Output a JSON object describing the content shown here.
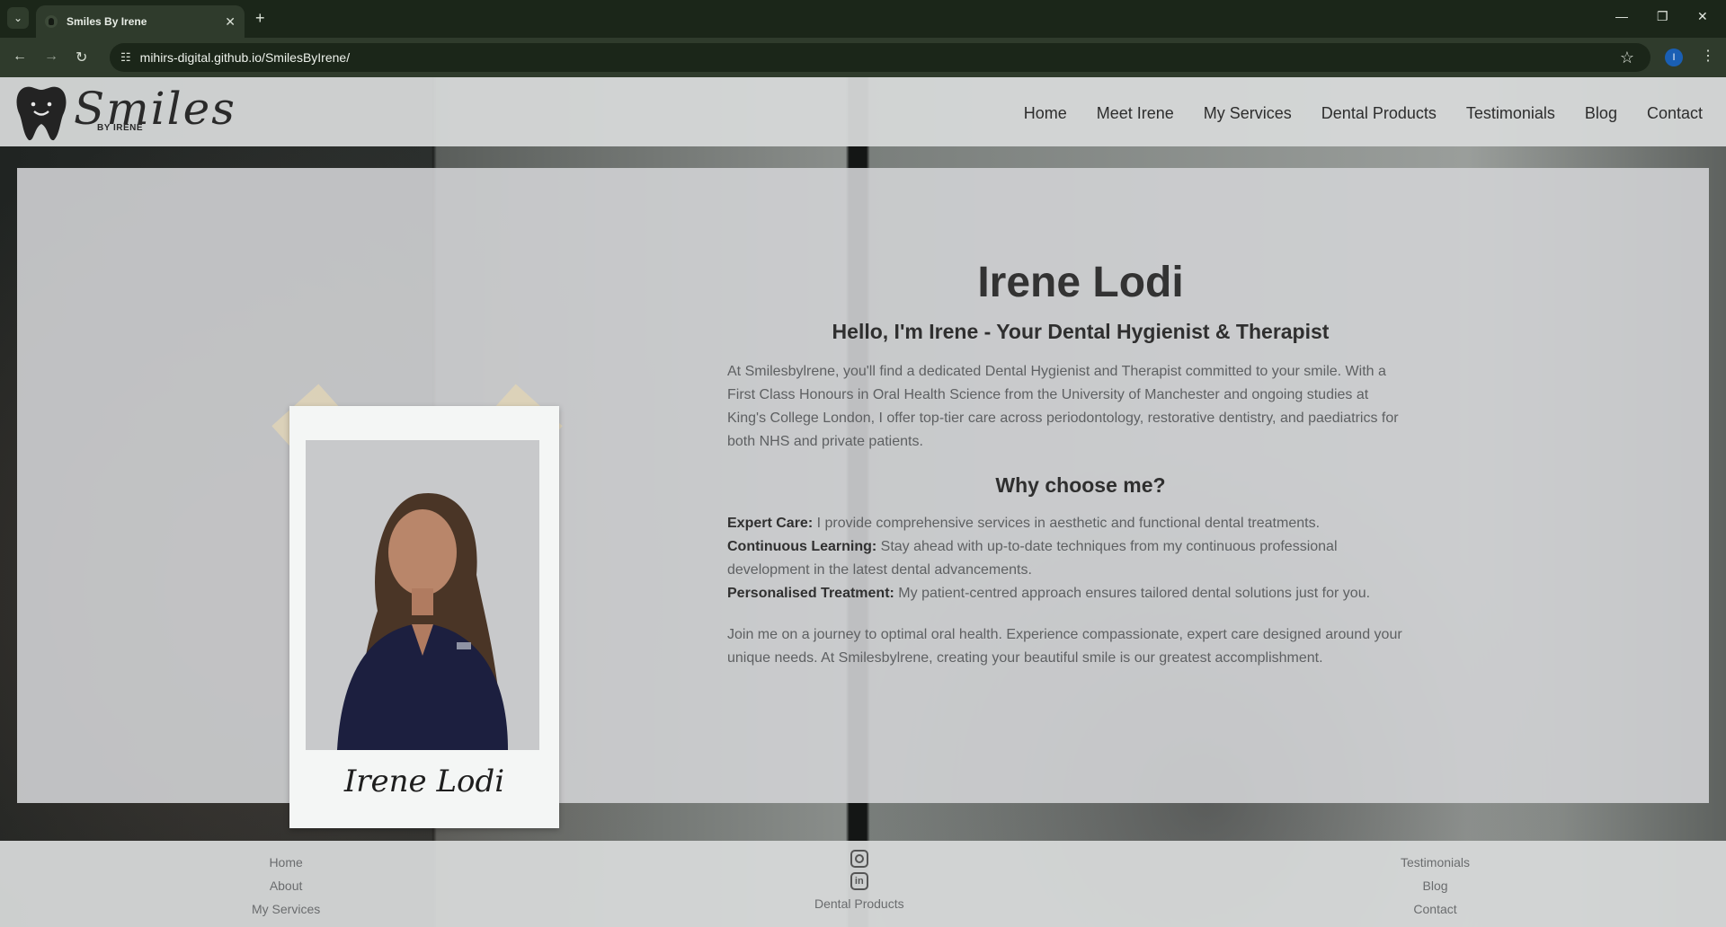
{
  "browser": {
    "tab_title": "Smiles By Irene",
    "url": "mihirs-digital.github.io/SmilesByIrene/",
    "profile_initial": "I"
  },
  "header": {
    "brand": "Smiles",
    "brand_sub": "BY IRENE",
    "nav": [
      "Home",
      "Meet Irene",
      "My Services",
      "Dental Products",
      "Testimonials",
      "Blog",
      "Contact"
    ]
  },
  "profile": {
    "signature": "Irene Lodi",
    "name": "Irene Lodi",
    "tagline": "Hello, I'm Irene - Your Dental Hygienist & Therapist",
    "intro": "At Smilesbylrene, you'll find a dedicated Dental Hygienist and Therapist committed to your smile. With a First Class Honours in Oral Health Science from the University of Manchester and ongoing studies at King's College London, I offer top-tier care across periodontology, restorative dentistry, and paediatrics for both NHS and private patients.",
    "why_title": "Why choose me?",
    "features": [
      {
        "title": "Expert Care:",
        "text": " I provide comprehensive services in aesthetic and functional dental treatments."
      },
      {
        "title": "Continuous Learning:",
        "text": " Stay ahead with up-to-date techniques from my continuous professional development in the latest dental advancements."
      },
      {
        "title": "Personalised Treatment:",
        "text": " My patient-centred approach ensures tailored dental solutions just for you."
      }
    ],
    "closing": "Join me on a journey to optimal oral health. Experience compassionate, expert care designed around your unique needs. At Smilesbylrene, creating your beautiful smile is our greatest accomplishment."
  },
  "footer": {
    "left": [
      "Home",
      "About",
      "My Services"
    ],
    "center": [
      "Dental Products"
    ],
    "right": [
      "Testimonials",
      "Blog",
      "Contact"
    ]
  }
}
